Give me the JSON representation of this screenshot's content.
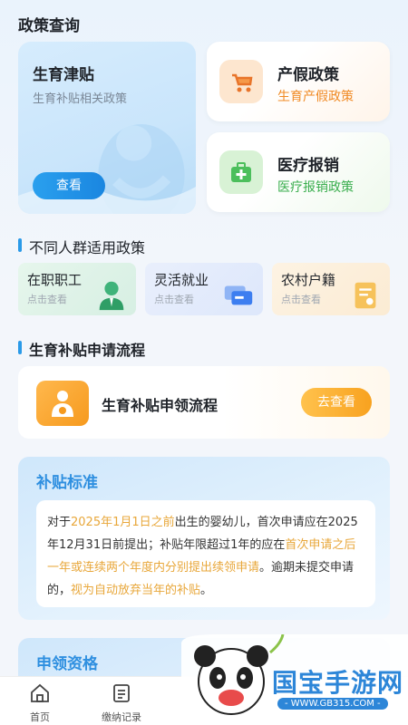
{
  "header": {
    "title": "政策查询"
  },
  "featured": {
    "title": "生育津贴",
    "subtitle": "生育补贴相关政策",
    "button": "查看"
  },
  "cards": [
    {
      "title": "产假政策",
      "subtitle": "生育产假政策",
      "icon": "stroller-icon",
      "color": "#f08a24"
    },
    {
      "title": "医疗报销",
      "subtitle": "医疗报销政策",
      "icon": "medical-kit-icon",
      "color": "#3aae4e"
    }
  ],
  "groups_section": {
    "title": "不同人群适用政策",
    "items": [
      {
        "title": "在职职工",
        "subtitle": "点击查看",
        "icon": "worker-icon"
      },
      {
        "title": "灵活就业",
        "subtitle": "点击查看",
        "icon": "cards-icon"
      },
      {
        "title": "农村户籍",
        "subtitle": "点击查看",
        "icon": "document-icon"
      }
    ]
  },
  "process_section": {
    "title": "生育补贴申请流程",
    "card_title": "生育补贴申领流程",
    "button": "去查看"
  },
  "standard": {
    "title": "补贴标准",
    "p1": "对于",
    "p2": "2025年1月1日之前",
    "p3": "出生的婴幼儿，首次申请应在2025年12月31日前提出；补贴年限超过1年的应在",
    "p4": "首次申请之后一年或连续两个年度内分别提出续领申请",
    "p5": "。逾期未提交申请的，",
    "p6": "视为自动放弃当年的补贴",
    "p7": "。"
  },
  "eligibility": {
    "title": "申领资格"
  },
  "tabbar": [
    {
      "label": "首页",
      "icon": "home-icon"
    },
    {
      "label": "缴纳记录",
      "icon": "record-icon"
    }
  ],
  "watermark": {
    "text": "国宝手游网",
    "url": "- WWW.GB315.COM -"
  },
  "colors": {
    "accent": "#2a9ae8",
    "orange": "#f08a24",
    "green": "#3aae4e",
    "highlight": "#e8a73a"
  }
}
